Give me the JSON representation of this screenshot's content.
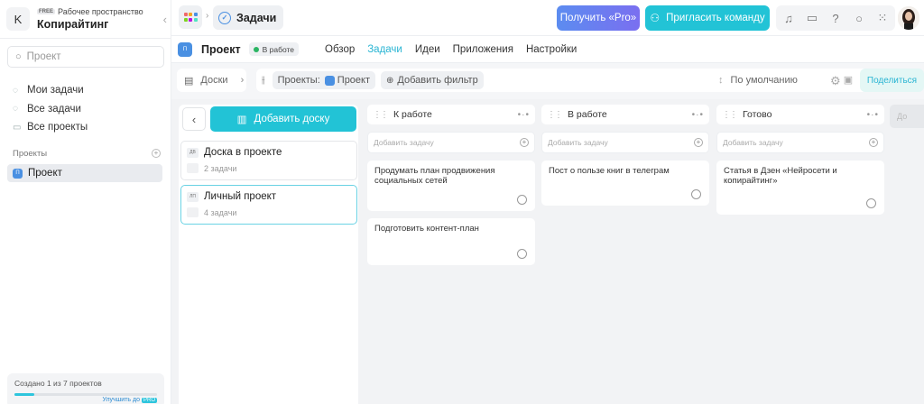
{
  "workspace": {
    "initial": "K",
    "plan_badge": "FREE",
    "label": "Рабочее пространство",
    "name": "Копирайтинг"
  },
  "sidebar": {
    "search_placeholder": "Проект",
    "nav": [
      {
        "label": "Мои задачи",
        "icon": "check-circle-icon"
      },
      {
        "label": "Все задачи",
        "icon": "check-circle-icon"
      },
      {
        "label": "Все проекты",
        "icon": "folder-icon"
      }
    ],
    "projects_title": "Проекты",
    "projects": [
      {
        "label": "Проект",
        "icon_text": "П"
      }
    ],
    "footer": {
      "text": "Создано 1 из 7 проектов",
      "progress": 0.14,
      "upgrade_label": "Улучшить до",
      "upgrade_badge": "PRO"
    }
  },
  "topbar": {
    "crumb_title": "Задачи",
    "pro_button": "Получить «Pro»",
    "invite_button": "Пригласить команду",
    "icons": [
      "bell-icon",
      "folder-icon",
      "help-icon",
      "search-icon",
      "apps-grid-icon"
    ]
  },
  "project": {
    "icon_text": "П",
    "title": "Проект",
    "status": "В работе",
    "tabs": [
      {
        "label": "Обзор",
        "active": false
      },
      {
        "label": "Задачи",
        "active": true
      },
      {
        "label": "Идеи",
        "active": false
      },
      {
        "label": "Приложения",
        "active": false
      },
      {
        "label": "Настройки",
        "active": false
      }
    ]
  },
  "toolbar": {
    "boards_label": "Доски",
    "projects_filter_label": "Проекты:",
    "projects_filter_value": "Проект",
    "add_filter": "Добавить фильтр",
    "sort_label": "По умолчанию",
    "share_button": "Поделиться"
  },
  "board": {
    "add_board_button": "Добавить доску",
    "boards": [
      {
        "tag": "ДВ",
        "name": "Доска в проекте",
        "count": "2 задачи",
        "selected": false
      },
      {
        "tag": "ЛП",
        "name": "Личный проект",
        "count": "4 задачи",
        "selected": true
      }
    ],
    "add_task_placeholder": "Добавить задачу",
    "columns": [
      {
        "title": "К работе",
        "tasks": [
          "Продумать план продвижения социальных сетей",
          "Подготовить контент-план"
        ]
      },
      {
        "title": "В работе",
        "tasks": [
          "Пост о пользе книг в телеграм"
        ]
      },
      {
        "title": "Готово",
        "tasks": [
          "Статья в Дзен «Нейросети и копирайтинг»"
        ]
      }
    ],
    "ghost_column_label": "До"
  },
  "colors": {
    "accent": "#22c3d6",
    "pro_gradient_start": "#5c8cf0",
    "pro_gradient_end": "#7a6ff0",
    "project_blue": "#4a90e2",
    "status_green": "#2bb563"
  }
}
